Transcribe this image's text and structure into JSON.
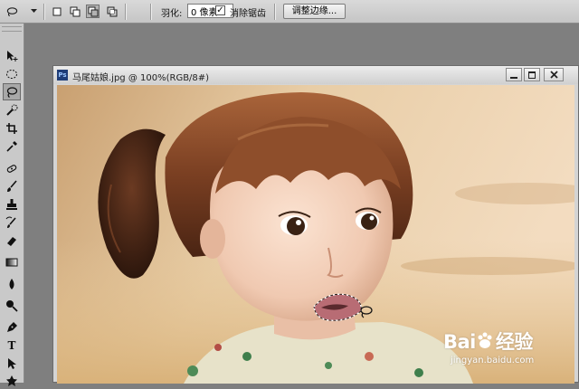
{
  "options_bar": {
    "feather_label": "羽化:",
    "feather_value": "0 像素",
    "antialias_label": "消除锯齿",
    "antialias_checked": "✓",
    "refine_edge_label": "调整边缘..."
  },
  "document": {
    "title": "马尾姑娘.jpg @ 100%(RGB/8#)",
    "app_icon_text": "Ps"
  },
  "watermark": {
    "logo_text": "Bai",
    "logo_suffix": "经验",
    "url": "jingyan.baidu.com"
  },
  "colors": {
    "accent_toolbar": "#c9c9c9",
    "workspace": "#7f7f7f"
  },
  "tools": [
    "move-tool",
    "marquee-tool",
    "lasso-tool",
    "quick-selection-tool",
    "crop-tool",
    "eyedropper-tool",
    "healing-brush-tool",
    "brush-tool",
    "clone-stamp-tool",
    "history-brush-tool",
    "eraser-tool",
    "gradient-tool",
    "blur-tool",
    "dodge-tool",
    "pen-tool",
    "type-tool",
    "path-selection-tool",
    "shape-tool"
  ],
  "type_tool_glyph": "T"
}
